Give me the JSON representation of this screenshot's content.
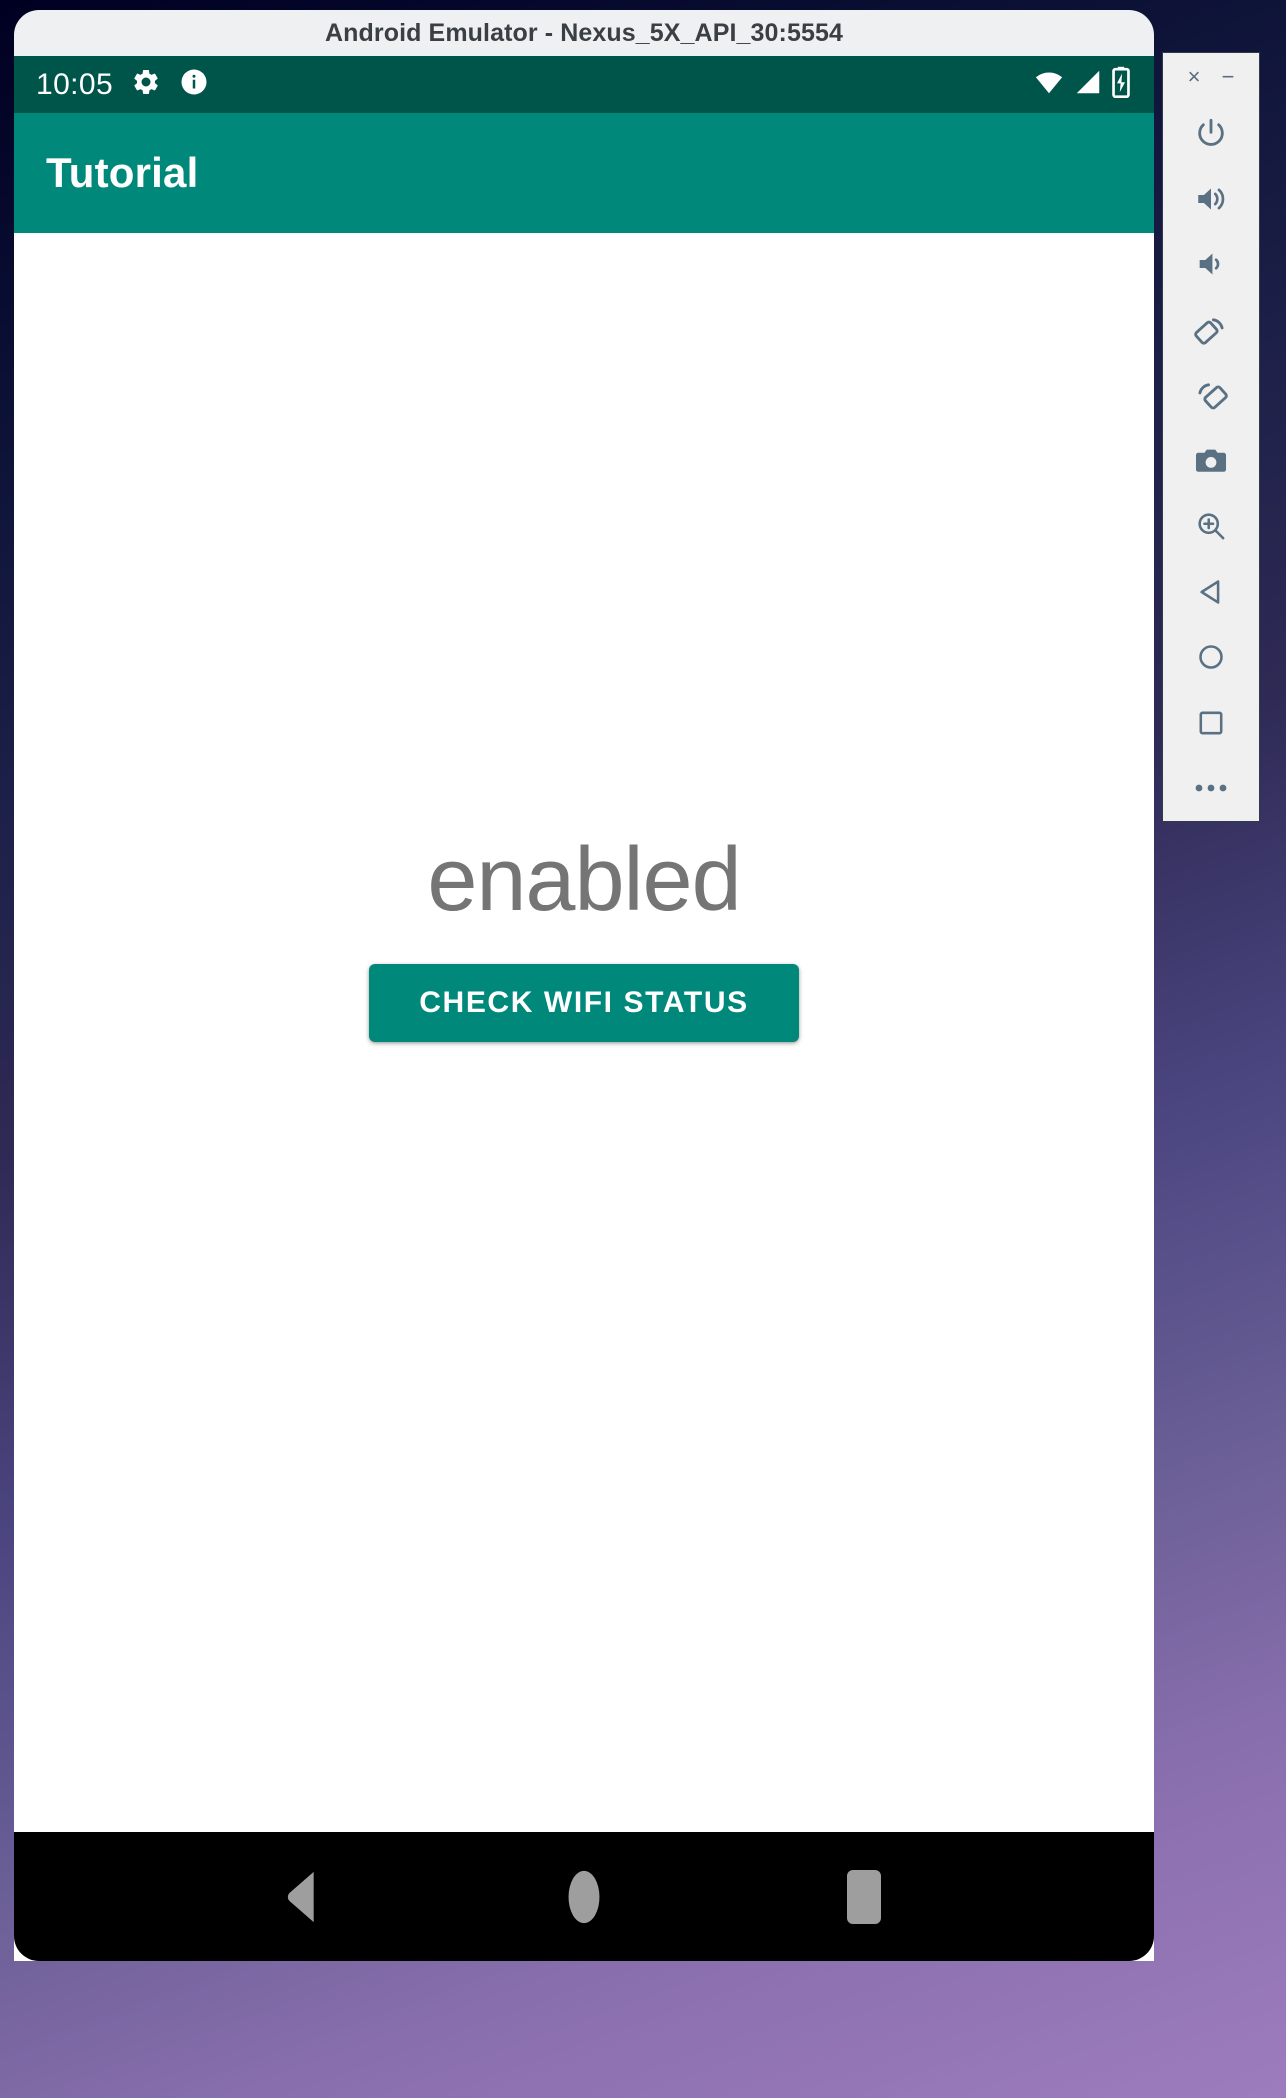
{
  "window": {
    "title": "Android Emulator - Nexus_5X_API_30:5554"
  },
  "android": {
    "status_bar": {
      "clock": "10:05",
      "icons_left": [
        "gear-icon",
        "info-icon"
      ],
      "icons_right": [
        "wifi-icon",
        "cell-signal-icon",
        "battery-charging-icon"
      ],
      "background_color": "#00554a"
    },
    "app_bar": {
      "title": "Tutorial",
      "background_color": "#00897b"
    },
    "content": {
      "status_text": "enabled",
      "status_text_color": "#757575",
      "button_label": "CHECK WIFI STATUS",
      "button_color": "#00897b"
    },
    "nav_bar": {
      "back_label": "Back",
      "home_label": "Home",
      "recents_label": "Recents",
      "background_color": "#000000"
    }
  },
  "emulator_toolbar": {
    "close_label": "×",
    "minimize_label": "−",
    "buttons": [
      {
        "name": "power-button",
        "icon": "power-icon"
      },
      {
        "name": "volume-up-button",
        "icon": "volume-up-icon"
      },
      {
        "name": "volume-down-button",
        "icon": "volume-down-icon"
      },
      {
        "name": "rotate-left-button",
        "icon": "rotate-left-icon"
      },
      {
        "name": "rotate-right-button",
        "icon": "rotate-right-icon"
      },
      {
        "name": "screenshot-button",
        "icon": "camera-icon"
      },
      {
        "name": "zoom-button",
        "icon": "zoom-in-icon"
      },
      {
        "name": "back-button",
        "icon": "triangle-left-icon"
      },
      {
        "name": "home-button",
        "icon": "circle-icon"
      },
      {
        "name": "overview-button",
        "icon": "square-icon"
      },
      {
        "name": "more-button",
        "icon": "ellipsis-icon"
      }
    ],
    "icon_color": "#5a7183",
    "background_color": "#f0f0f0"
  }
}
